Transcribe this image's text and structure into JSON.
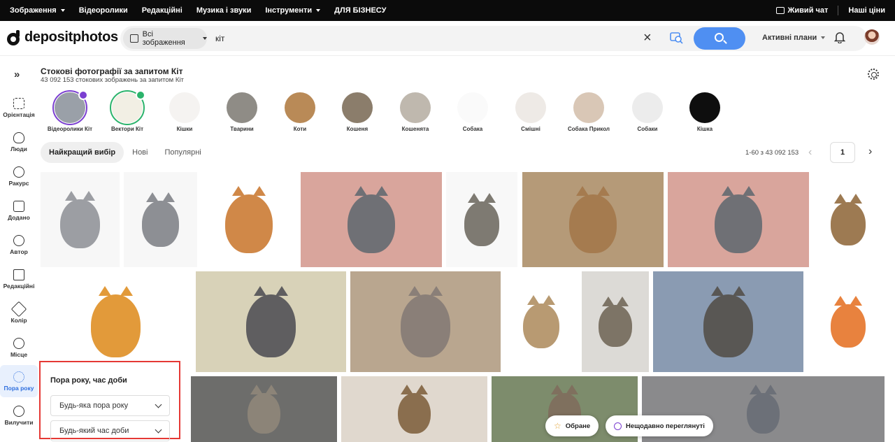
{
  "topbar": {
    "nav": [
      "Зображення",
      "Відеоролики",
      "Редакційні",
      "Музика і звуки",
      "Інструменти",
      "ДЛЯ БІЗНЕСУ"
    ],
    "live_chat": "Живий чат",
    "prices": "Наші ціни"
  },
  "header": {
    "logo": "depositphotos",
    "scope": "Всі зображення",
    "query": "кіт",
    "plans": "Активні плани"
  },
  "sidebar": [
    {
      "label": "Орієнтація",
      "icon": "orientation-icon"
    },
    {
      "label": "Люди",
      "icon": "people-icon"
    },
    {
      "label": "Ракурс",
      "icon": "angle-icon"
    },
    {
      "label": "Додано",
      "icon": "calendar-icon"
    },
    {
      "label": "Автор",
      "icon": "author-icon"
    },
    {
      "label": "Редакційні",
      "icon": "editorial-icon"
    },
    {
      "label": "Колір",
      "icon": "color-bucket-icon"
    },
    {
      "label": "Місце",
      "icon": "globe-icon"
    },
    {
      "label": "Пора року",
      "icon": "season-icon"
    },
    {
      "label": "Вилучити",
      "icon": "exclude-icon"
    }
  ],
  "results": {
    "title": "Стокові фотографії за запитом Кіт",
    "count": "43 092 153 стокових зображень за запитом Кіт"
  },
  "related": [
    {
      "label": "Відеоролики Кіт",
      "color": "#9aa0a8",
      "ring": "#7b3fd1",
      "badge": "#7b3fd1"
    },
    {
      "label": "Вектори Кіт",
      "color": "#f2efe4",
      "ring": "#2bb36b",
      "badge": "#2bb36b"
    },
    {
      "label": "Кішки",
      "color": "#f5f3f1",
      "ring": "",
      "badge": ""
    },
    {
      "label": "Тварини",
      "color": "#8f8c86",
      "ring": "",
      "badge": ""
    },
    {
      "label": "Коти",
      "color": "#b98a57",
      "ring": "",
      "badge": ""
    },
    {
      "label": "Кошеня",
      "color": "#8b7d6b",
      "ring": "",
      "badge": ""
    },
    {
      "label": "Кошенята",
      "color": "#bfb8ae",
      "ring": "",
      "badge": ""
    },
    {
      "label": "Собака",
      "color": "#fafafa",
      "ring": "",
      "badge": ""
    },
    {
      "label": "Смішні",
      "color": "#eeeae6",
      "ring": "",
      "badge": ""
    },
    {
      "label": "Собака Прикол",
      "color": "#d9c7b6",
      "ring": "",
      "badge": ""
    },
    {
      "label": "Собаки",
      "color": "#ececec",
      "ring": "",
      "badge": ""
    },
    {
      "label": "Кішка",
      "color": "#0e0e0e",
      "ring": "",
      "badge": ""
    }
  ],
  "tabs": [
    "Найкращий вибір",
    "Нові",
    "Популярні"
  ],
  "pager": {
    "range": "1-60 з 43 092 153",
    "page": "1"
  },
  "tiles": [
    {
      "bg": "#f7f7f7",
      "cat": "#9c9ea3"
    },
    {
      "bg": "#f7f7f7",
      "cat": "#8d8f94"
    },
    {
      "bg": "#ffffff",
      "cat": "#d08848"
    },
    {
      "bg": "#d9a59c",
      "cat": "#6f7075"
    },
    {
      "bg": "#f8f8f8",
      "cat": "#7e7a72"
    },
    {
      "bg": "#b59a78",
      "cat": "#a57b4f"
    },
    {
      "bg": "#d9a59c",
      "cat": "#6f7075"
    },
    {
      "bg": "#ffffff",
      "cat": "#9d7a52"
    },
    {
      "bg": "#ffffff",
      "cat": "#e29a3a"
    },
    {
      "bg": "#d8d2b8",
      "cat": "#5f5e60"
    },
    {
      "bg": "#b9a68f",
      "cat": "#8a7f78"
    },
    {
      "bg": "#ffffff",
      "cat": "#b89a72"
    },
    {
      "bg": "#dcdad6",
      "cat": "#7d7466"
    },
    {
      "bg": "#8a9bb2",
      "cat": "#595754"
    },
    {
      "bg": "#ffffff",
      "cat": "#e8823e"
    },
    {
      "bg": "#6d6d6b",
      "cat": "#8c8478"
    },
    {
      "bg": "#e0d8ce",
      "cat": "#8a6e4e"
    },
    {
      "bg": "#7d8c6c",
      "cat": "#7f705e"
    },
    {
      "bg": "#8a8a8c",
      "cat": "#6c7078"
    }
  ],
  "pills": {
    "favorites": "Обране",
    "recent": "Нещодавно переглянуті"
  },
  "filter": {
    "title": "Пора року, час доби",
    "season": "Будь-яка пора року",
    "time": "Будь-який час доби"
  },
  "colors": {
    "accent": "#4f8ff2",
    "active": "#2f6fde",
    "highlight": "#e53935"
  }
}
